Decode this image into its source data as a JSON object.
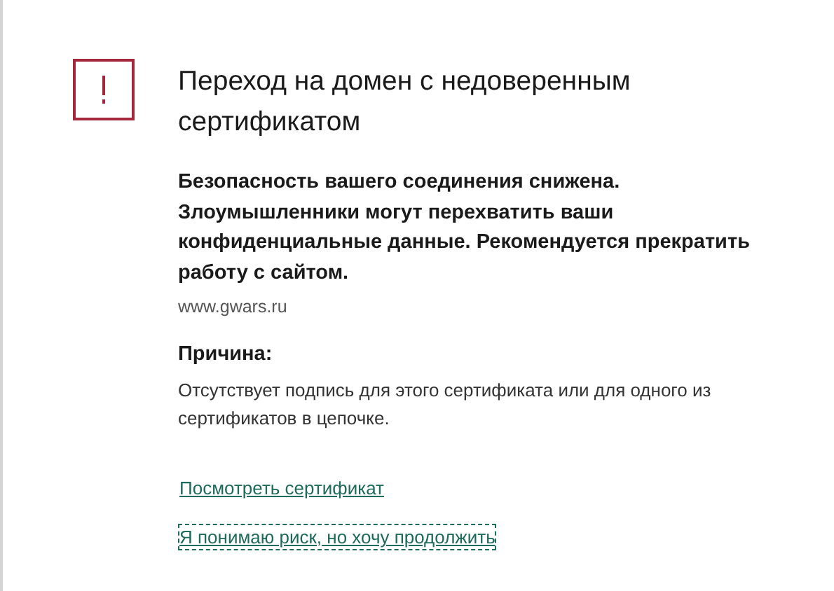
{
  "title": "Переход на домен с недоверенным сертификатом",
  "warning": "Безопасность вашего соединения снижена. Злоумышленники могут перехватить ваши конфиденциальные данные. Рекомендуется прекратить работу с сайтом.",
  "url": "www.gwars.ru",
  "reason_heading": "Причина:",
  "reason": "Отсутствует подпись для этого сертификата или для одного из сертификатов в цепочке.",
  "links": [
    {
      "label": "Посмотреть сертификат",
      "focused": false
    },
    {
      "label": "Я понимаю риск, но хочу продолжить",
      "focused": true
    }
  ]
}
